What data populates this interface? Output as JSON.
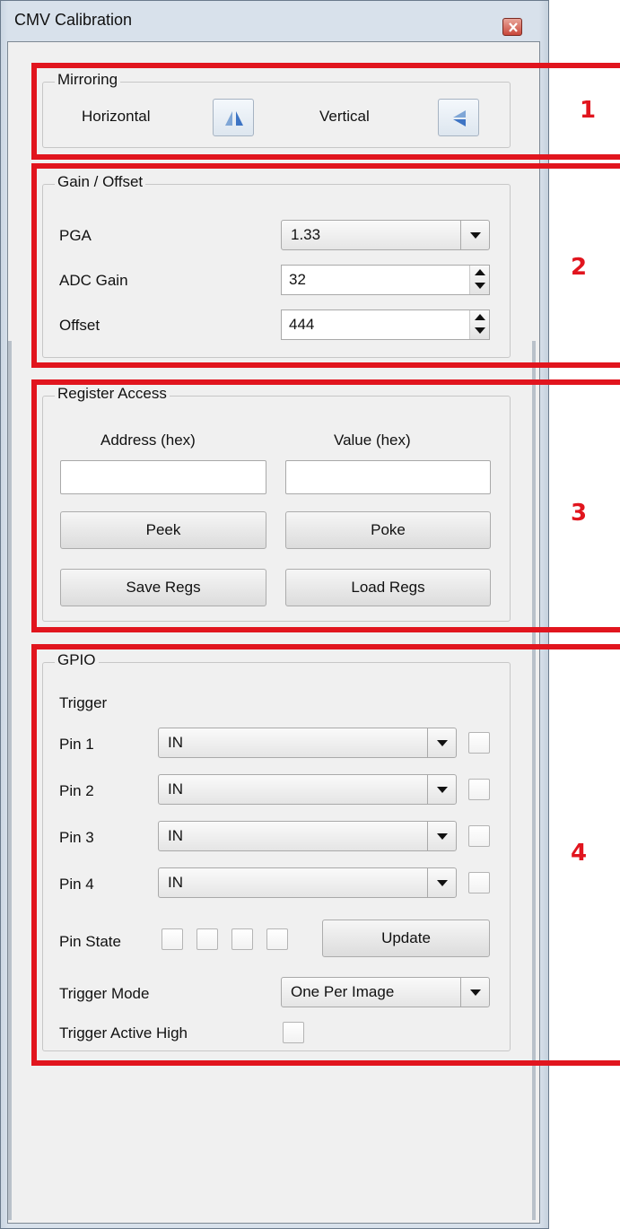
{
  "window": {
    "title": "CMV Calibration"
  },
  "mirroring": {
    "title": "Mirroring",
    "horizontal_label": "Horizontal",
    "vertical_label": "Vertical"
  },
  "gain_offset": {
    "title": "Gain / Offset",
    "pga_label": "PGA",
    "pga_value": "1.33",
    "adc_gain_label": "ADC Gain",
    "adc_gain_value": "32",
    "offset_label": "Offset",
    "offset_value": "444"
  },
  "register_access": {
    "title": "Register Access",
    "address_label": "Address (hex)",
    "value_label": "Value (hex)",
    "address_value": "",
    "value_value": "",
    "peek_label": "Peek",
    "poke_label": "Poke",
    "save_label": "Save Regs",
    "load_label": "Load Regs"
  },
  "gpio": {
    "title": "GPIO",
    "trigger_label": "Trigger",
    "pins": [
      {
        "label": "Pin 1",
        "mode": "IN",
        "checked": false
      },
      {
        "label": "Pin 2",
        "mode": "IN",
        "checked": false
      },
      {
        "label": "Pin 3",
        "mode": "IN",
        "checked": false
      },
      {
        "label": "Pin 4",
        "mode": "IN",
        "checked": false
      }
    ],
    "pin_state_label": "Pin State",
    "update_label": "Update",
    "trigger_mode_label": "Trigger Mode",
    "trigger_mode_value": "One Per Image",
    "trigger_active_high_label": "Trigger Active High"
  },
  "annotations": [
    "1",
    "2",
    "3",
    "4"
  ],
  "colors": {
    "annotation": "#e1151e",
    "window_frame": "#d8e1eb",
    "panel": "#f0f0f0"
  }
}
